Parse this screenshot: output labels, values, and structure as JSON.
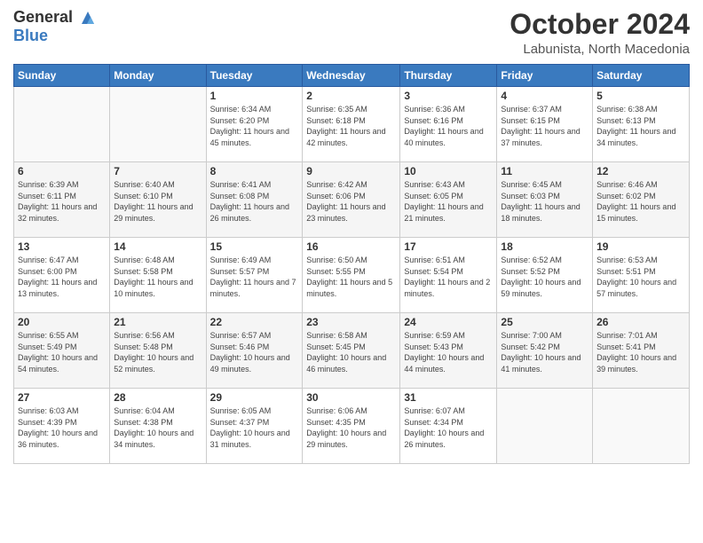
{
  "header": {
    "logo_general": "General",
    "logo_blue": "Blue",
    "month_year": "October 2024",
    "location": "Labunista, North Macedonia"
  },
  "weekdays": [
    "Sunday",
    "Monday",
    "Tuesday",
    "Wednesday",
    "Thursday",
    "Friday",
    "Saturday"
  ],
  "weeks": [
    [
      {
        "day": "",
        "info": ""
      },
      {
        "day": "",
        "info": ""
      },
      {
        "day": "1",
        "info": "Sunrise: 6:34 AM\nSunset: 6:20 PM\nDaylight: 11 hours and 45 minutes."
      },
      {
        "day": "2",
        "info": "Sunrise: 6:35 AM\nSunset: 6:18 PM\nDaylight: 11 hours and 42 minutes."
      },
      {
        "day": "3",
        "info": "Sunrise: 6:36 AM\nSunset: 6:16 PM\nDaylight: 11 hours and 40 minutes."
      },
      {
        "day": "4",
        "info": "Sunrise: 6:37 AM\nSunset: 6:15 PM\nDaylight: 11 hours and 37 minutes."
      },
      {
        "day": "5",
        "info": "Sunrise: 6:38 AM\nSunset: 6:13 PM\nDaylight: 11 hours and 34 minutes."
      }
    ],
    [
      {
        "day": "6",
        "info": "Sunrise: 6:39 AM\nSunset: 6:11 PM\nDaylight: 11 hours and 32 minutes."
      },
      {
        "day": "7",
        "info": "Sunrise: 6:40 AM\nSunset: 6:10 PM\nDaylight: 11 hours and 29 minutes."
      },
      {
        "day": "8",
        "info": "Sunrise: 6:41 AM\nSunset: 6:08 PM\nDaylight: 11 hours and 26 minutes."
      },
      {
        "day": "9",
        "info": "Sunrise: 6:42 AM\nSunset: 6:06 PM\nDaylight: 11 hours and 23 minutes."
      },
      {
        "day": "10",
        "info": "Sunrise: 6:43 AM\nSunset: 6:05 PM\nDaylight: 11 hours and 21 minutes."
      },
      {
        "day": "11",
        "info": "Sunrise: 6:45 AM\nSunset: 6:03 PM\nDaylight: 11 hours and 18 minutes."
      },
      {
        "day": "12",
        "info": "Sunrise: 6:46 AM\nSunset: 6:02 PM\nDaylight: 11 hours and 15 minutes."
      }
    ],
    [
      {
        "day": "13",
        "info": "Sunrise: 6:47 AM\nSunset: 6:00 PM\nDaylight: 11 hours and 13 minutes."
      },
      {
        "day": "14",
        "info": "Sunrise: 6:48 AM\nSunset: 5:58 PM\nDaylight: 11 hours and 10 minutes."
      },
      {
        "day": "15",
        "info": "Sunrise: 6:49 AM\nSunset: 5:57 PM\nDaylight: 11 hours and 7 minutes."
      },
      {
        "day": "16",
        "info": "Sunrise: 6:50 AM\nSunset: 5:55 PM\nDaylight: 11 hours and 5 minutes."
      },
      {
        "day": "17",
        "info": "Sunrise: 6:51 AM\nSunset: 5:54 PM\nDaylight: 11 hours and 2 minutes."
      },
      {
        "day": "18",
        "info": "Sunrise: 6:52 AM\nSunset: 5:52 PM\nDaylight: 10 hours and 59 minutes."
      },
      {
        "day": "19",
        "info": "Sunrise: 6:53 AM\nSunset: 5:51 PM\nDaylight: 10 hours and 57 minutes."
      }
    ],
    [
      {
        "day": "20",
        "info": "Sunrise: 6:55 AM\nSunset: 5:49 PM\nDaylight: 10 hours and 54 minutes."
      },
      {
        "day": "21",
        "info": "Sunrise: 6:56 AM\nSunset: 5:48 PM\nDaylight: 10 hours and 52 minutes."
      },
      {
        "day": "22",
        "info": "Sunrise: 6:57 AM\nSunset: 5:46 PM\nDaylight: 10 hours and 49 minutes."
      },
      {
        "day": "23",
        "info": "Sunrise: 6:58 AM\nSunset: 5:45 PM\nDaylight: 10 hours and 46 minutes."
      },
      {
        "day": "24",
        "info": "Sunrise: 6:59 AM\nSunset: 5:43 PM\nDaylight: 10 hours and 44 minutes."
      },
      {
        "day": "25",
        "info": "Sunrise: 7:00 AM\nSunset: 5:42 PM\nDaylight: 10 hours and 41 minutes."
      },
      {
        "day": "26",
        "info": "Sunrise: 7:01 AM\nSunset: 5:41 PM\nDaylight: 10 hours and 39 minutes."
      }
    ],
    [
      {
        "day": "27",
        "info": "Sunrise: 6:03 AM\nSunset: 4:39 PM\nDaylight: 10 hours and 36 minutes."
      },
      {
        "day": "28",
        "info": "Sunrise: 6:04 AM\nSunset: 4:38 PM\nDaylight: 10 hours and 34 minutes."
      },
      {
        "day": "29",
        "info": "Sunrise: 6:05 AM\nSunset: 4:37 PM\nDaylight: 10 hours and 31 minutes."
      },
      {
        "day": "30",
        "info": "Sunrise: 6:06 AM\nSunset: 4:35 PM\nDaylight: 10 hours and 29 minutes."
      },
      {
        "day": "31",
        "info": "Sunrise: 6:07 AM\nSunset: 4:34 PM\nDaylight: 10 hours and 26 minutes."
      },
      {
        "day": "",
        "info": ""
      },
      {
        "day": "",
        "info": ""
      }
    ]
  ]
}
